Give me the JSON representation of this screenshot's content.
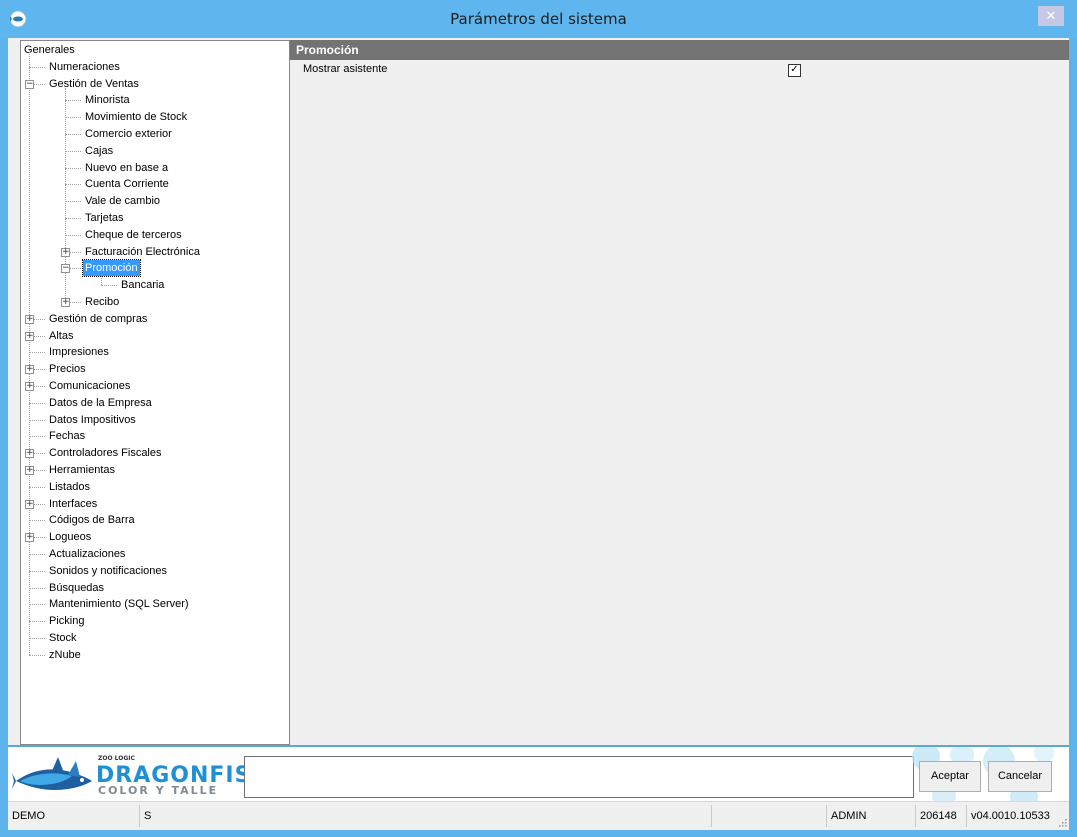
{
  "window": {
    "title": "Parámetros del sistema",
    "close_glyph": "✕"
  },
  "tree": {
    "root": "Generales",
    "items": [
      {
        "label": "Numeraciones"
      },
      {
        "label": "Gestión de Ventas",
        "expander": "−"
      },
      {
        "label": "Minorista"
      },
      {
        "label": "Movimiento de Stock"
      },
      {
        "label": "Comercio exterior"
      },
      {
        "label": "Cajas"
      },
      {
        "label": "Nuevo en base a"
      },
      {
        "label": "Cuenta Corriente"
      },
      {
        "label": "Vale de cambio"
      },
      {
        "label": "Tarjetas"
      },
      {
        "label": "Cheque de terceros"
      },
      {
        "label": "Facturación Electrónica",
        "expander": "+"
      },
      {
        "label": "Promoción",
        "expander": "−",
        "selected": true
      },
      {
        "label": "Bancaria"
      },
      {
        "label": "Recibo",
        "expander": "+"
      },
      {
        "label": "Gestión de compras",
        "expander": "+"
      },
      {
        "label": "Altas",
        "expander": "+"
      },
      {
        "label": "Impresiones"
      },
      {
        "label": "Precios",
        "expander": "+"
      },
      {
        "label": "Comunicaciones",
        "expander": "+"
      },
      {
        "label": "Datos de la Empresa"
      },
      {
        "label": "Datos Impositivos"
      },
      {
        "label": "Fechas"
      },
      {
        "label": "Controladores Fiscales",
        "expander": "+"
      },
      {
        "label": "Herramientas",
        "expander": "+"
      },
      {
        "label": "Listados"
      },
      {
        "label": "Interfaces",
        "expander": "+"
      },
      {
        "label": "Códigos de Barra"
      },
      {
        "label": "Logueos",
        "expander": "+"
      },
      {
        "label": "Actualizaciones"
      },
      {
        "label": "Sonidos y notificaciones"
      },
      {
        "label": "Búsquedas"
      },
      {
        "label": "Mantenimiento (SQL Server)"
      },
      {
        "label": "Picking"
      },
      {
        "label": "Stock"
      },
      {
        "label": "zNube"
      }
    ]
  },
  "panel": {
    "header": "Promoción",
    "settings": [
      {
        "label": "Mostrar asistente",
        "checked": true,
        "check_glyph": "✓"
      }
    ]
  },
  "logo": {
    "small": "ZOO LOGIC",
    "main": "DRAGONFISH",
    "sub": "COLOR Y TALLE"
  },
  "buttons": {
    "accept": "Aceptar",
    "cancel": "Cancelar"
  },
  "status": {
    "mode": "DEMO",
    "flag": "S",
    "user": "ADMIN",
    "code": "206148",
    "version": "v04.0010.10533"
  },
  "colors": {
    "titlebar": "#5fb5ee",
    "selection": "#3399ff",
    "panel_header": "#737373",
    "logo_blue": "#1f8fd6"
  }
}
